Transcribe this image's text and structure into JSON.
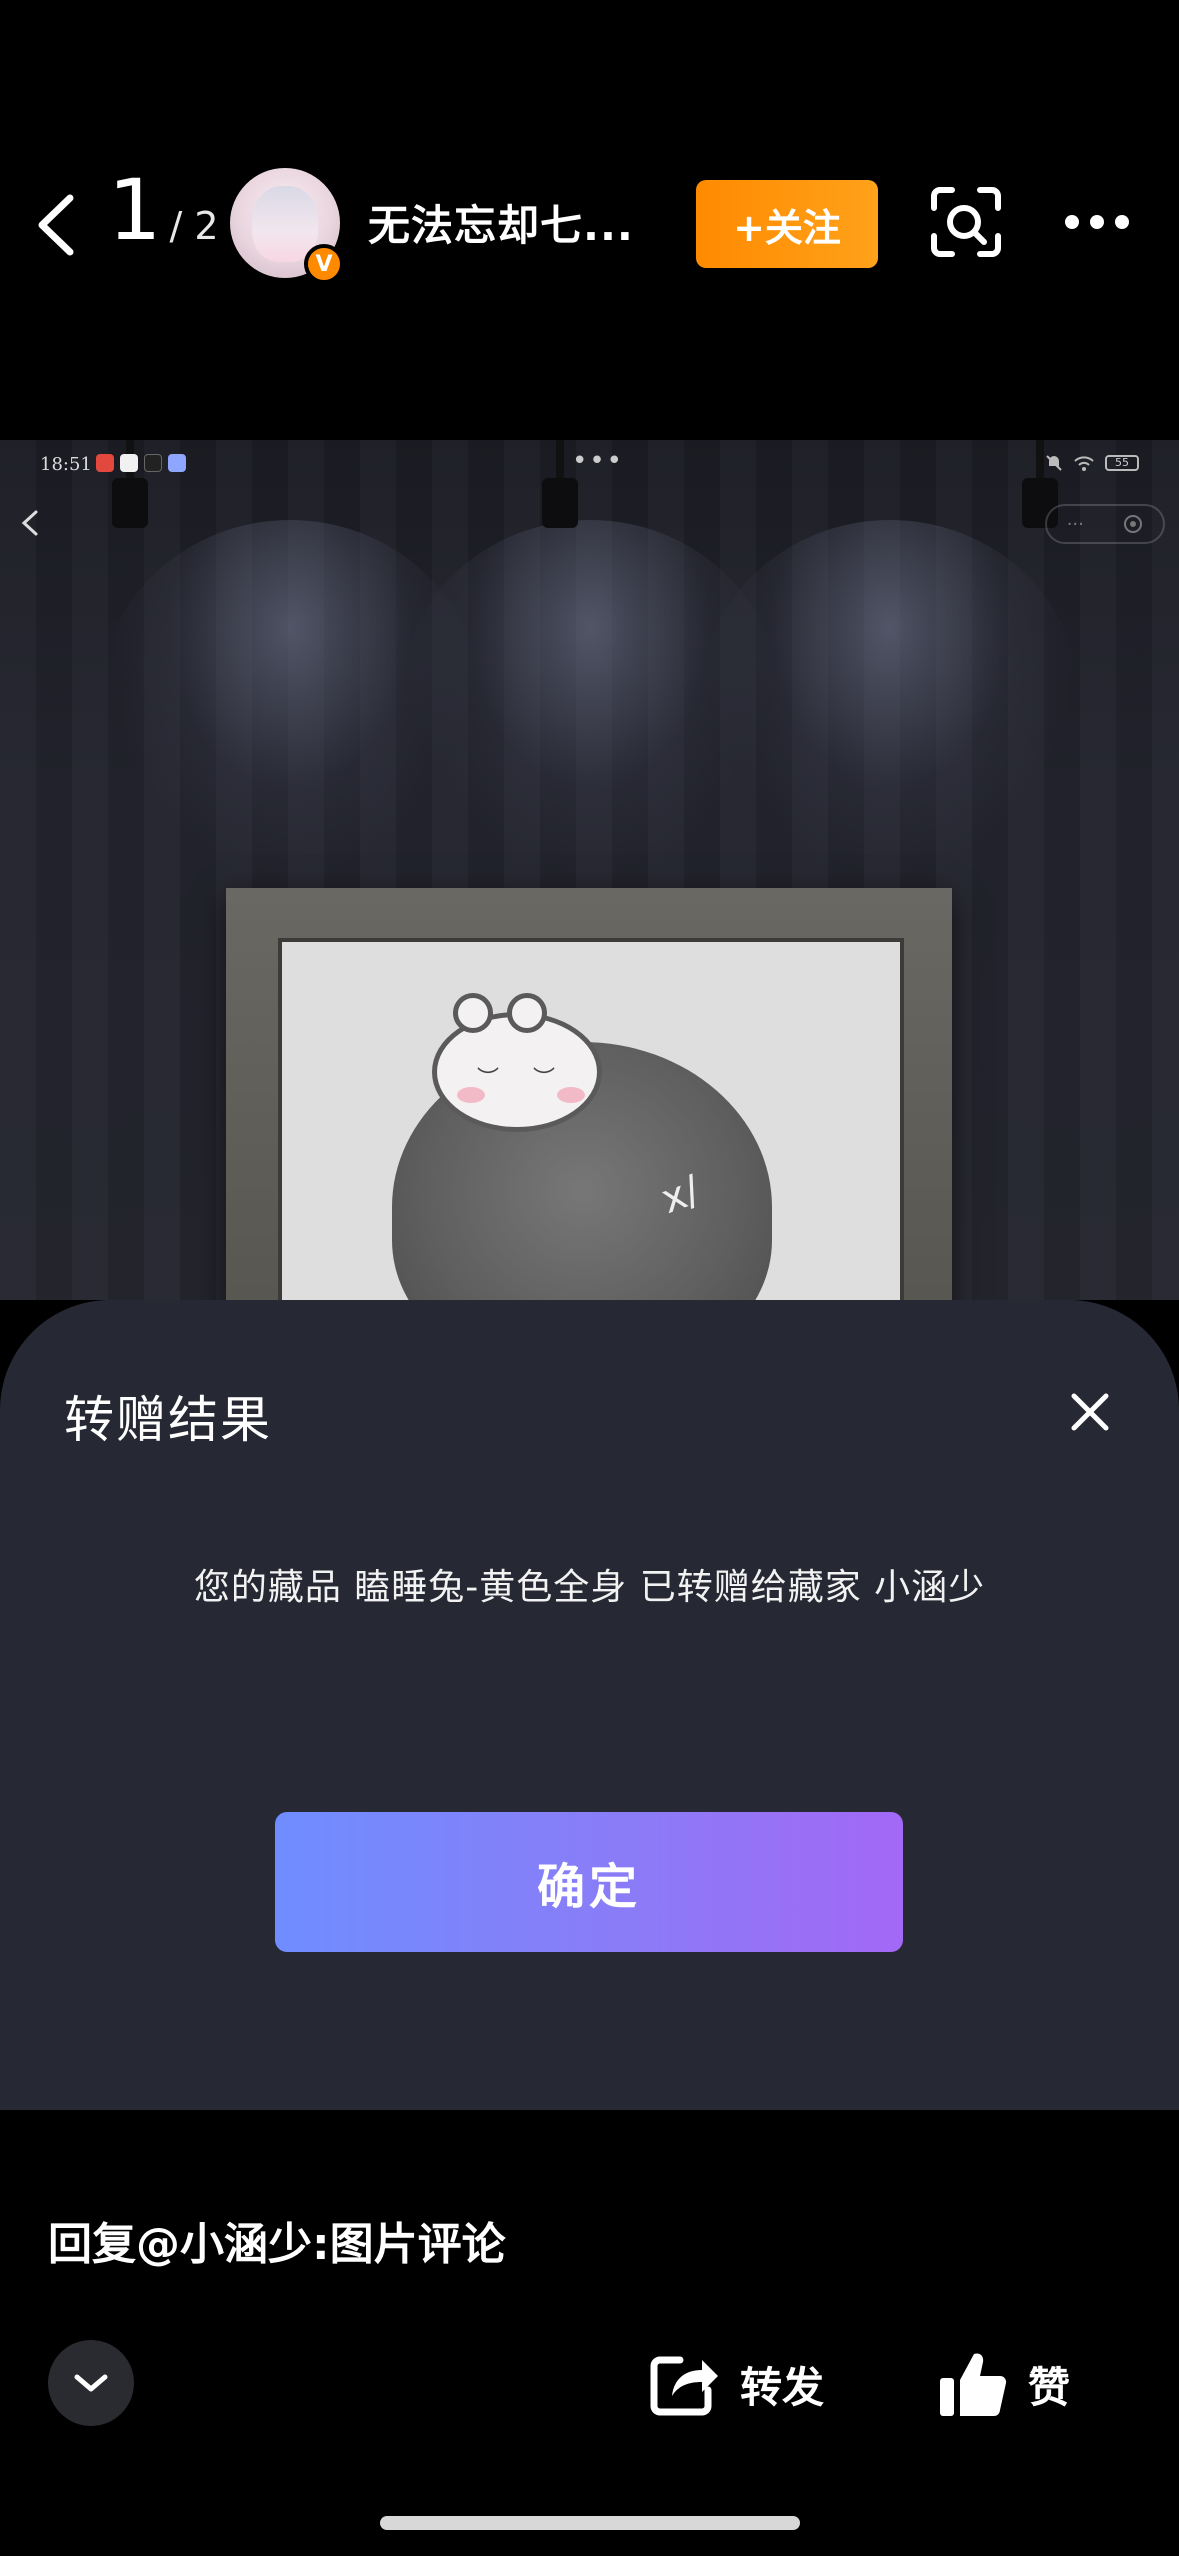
{
  "viewer": {
    "current_page": "1",
    "total_pages": "/ 2",
    "author_name": "无法忘却七...",
    "verified_badge": "V",
    "follow_label": "+关注",
    "icons": [
      "back-arrow-icon",
      "scan-icon",
      "more-icon"
    ]
  },
  "screenshot": {
    "status_time": "18:51",
    "menu_dots": "•••",
    "battery": "55",
    "capsule_dots": "···"
  },
  "dialog": {
    "title": "转赠结果",
    "message": "您的藏品 瞌睡兔-黄色全身 已转赠给藏家 小涵少",
    "confirm_label": "确定",
    "icons": [
      "close-icon"
    ]
  },
  "footer": {
    "reply_text": "回复@小涵少:图片评论",
    "share_label": "转发",
    "like_label": "赞",
    "icons": [
      "chevron-down-icon",
      "share-icon",
      "thumbs-up-icon"
    ]
  },
  "colors": {
    "background": "#000000",
    "follow_button": "#ff8a00",
    "sheet": "#262833",
    "confirm_gradient_start": "#6f8dff",
    "confirm_gradient_end": "#a268f6"
  }
}
